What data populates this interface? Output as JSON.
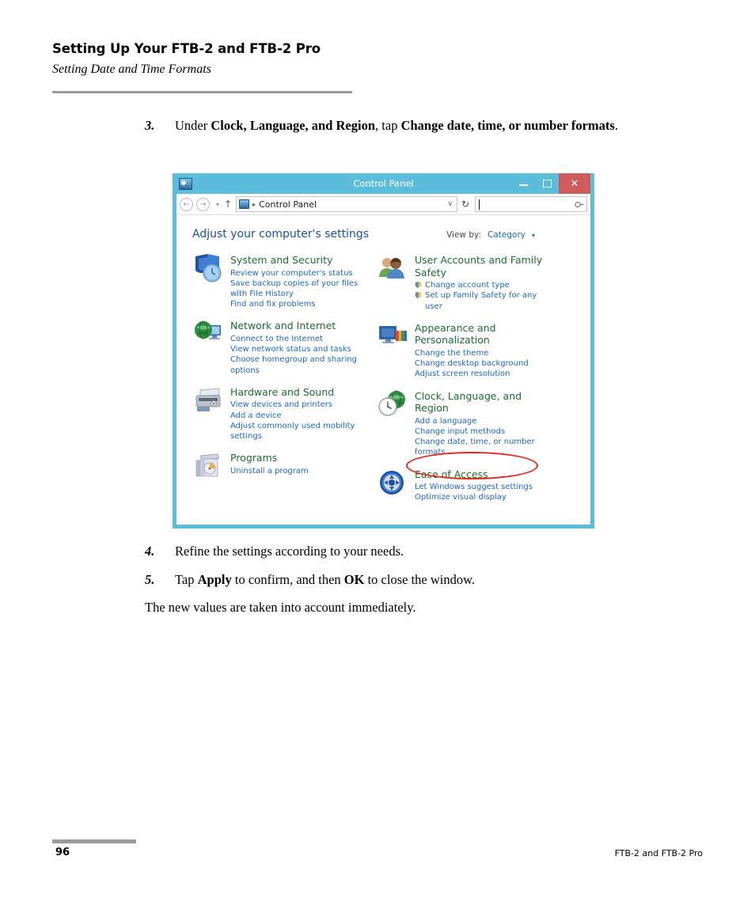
{
  "header": {
    "title": "Setting Up Your FTB-2 and FTB-2 Pro",
    "subtitle": "Setting Date and Time Formats"
  },
  "steps": {
    "step3": {
      "number": "3.",
      "parts": [
        {
          "text": "Under ",
          "bold": false
        },
        {
          "text": "Clock, Language, and Region",
          "bold": true
        },
        {
          "text": ", tap ",
          "bold": false
        },
        {
          "text": "Change date, time, or number formats",
          "bold": true
        },
        {
          "text": ".",
          "bold": false
        }
      ]
    },
    "step4": {
      "number": "4.",
      "parts": [
        {
          "text": "Refine the settings according to your needs.",
          "bold": false
        }
      ]
    },
    "step5": {
      "number": "5.",
      "parts": [
        {
          "text": "Tap ",
          "bold": false
        },
        {
          "text": "Apply",
          "bold": true
        },
        {
          "text": " to confirm, and then ",
          "bold": false
        },
        {
          "text": "OK",
          "bold": true
        },
        {
          "text": " to close the window.",
          "bold": false
        }
      ]
    },
    "closing": "The new values are taken into account immediately."
  },
  "control_panel": {
    "title": "Control Panel",
    "window_controls": {
      "minimize": "–",
      "maximize": "□",
      "close": "✕"
    },
    "address_bar": {
      "back_icon": "←",
      "forward_icon": "→",
      "history_caret": "▾",
      "up_icon": "↑",
      "path": "Control Panel",
      "path_separator": "▸",
      "dropdown_caret": "∨",
      "refresh_icon": "↻",
      "search_placeholder": "",
      "search_value": "",
      "search_icon": "search-icon"
    },
    "heading": "Adjust your computer's settings",
    "view_by": {
      "label": "View by:",
      "value": "Category",
      "caret": "▾"
    },
    "left_column": [
      {
        "icon": "shield-clock-icon",
        "title": "System and Security",
        "links": [
          {
            "text": "Review your computer's status",
            "shield": false
          },
          {
            "text": "Save backup copies of your files with File History",
            "shield": false
          },
          {
            "text": "Find and fix problems",
            "shield": false
          }
        ]
      },
      {
        "icon": "globe-monitor-icon",
        "title": "Network and Internet",
        "links": [
          {
            "text": "Connect to the Internet",
            "shield": false
          },
          {
            "text": "View network status and tasks",
            "shield": false
          },
          {
            "text": "Choose homegroup and sharing options",
            "shield": false
          }
        ]
      },
      {
        "icon": "printer-icon",
        "title": "Hardware and Sound",
        "links": [
          {
            "text": "View devices and printers",
            "shield": false
          },
          {
            "text": "Add a device",
            "shield": false
          },
          {
            "text": "Adjust commonly used mobility settings",
            "shield": false
          }
        ]
      },
      {
        "icon": "programs-box-icon",
        "title": "Programs",
        "links": [
          {
            "text": "Uninstall a program",
            "shield": false
          }
        ]
      }
    ],
    "right_column": [
      {
        "icon": "users-icon",
        "title": "User Accounts and Family Safety",
        "links": [
          {
            "text": "Change account type",
            "shield": true
          },
          {
            "text": "Set up Family Safety for any user",
            "shield": true
          }
        ]
      },
      {
        "icon": "monitor-palette-icon",
        "title": "Appearance and Personalization",
        "links": [
          {
            "text": "Change the theme",
            "shield": false
          },
          {
            "text": "Change desktop background",
            "shield": false
          },
          {
            "text": "Adjust screen resolution",
            "shield": false
          }
        ]
      },
      {
        "icon": "clock-globe-icon",
        "title": "Clock, Language, and Region",
        "links": [
          {
            "text": "Add a language",
            "shield": false
          },
          {
            "text": "Change input methods",
            "shield": false
          },
          {
            "text": "Change date, time, or number formats",
            "shield": false,
            "highlighted": true
          }
        ]
      },
      {
        "icon": "ease-of-access-icon",
        "title": "Ease of Access",
        "links": [
          {
            "text": "Let Windows suggest settings",
            "shield": false
          },
          {
            "text": "Optimize visual display",
            "shield": false
          }
        ]
      }
    ],
    "colors": {
      "titlebar": "#5cbcdc",
      "close_button": "#d05b5b",
      "category_title": "#1d6b32",
      "link": "#1f66c1",
      "heading": "#1f4f9c",
      "annotation": "#e8231a"
    }
  },
  "footer": {
    "page_number": "96",
    "product": "FTB-2 and FTB-2 Pro"
  }
}
